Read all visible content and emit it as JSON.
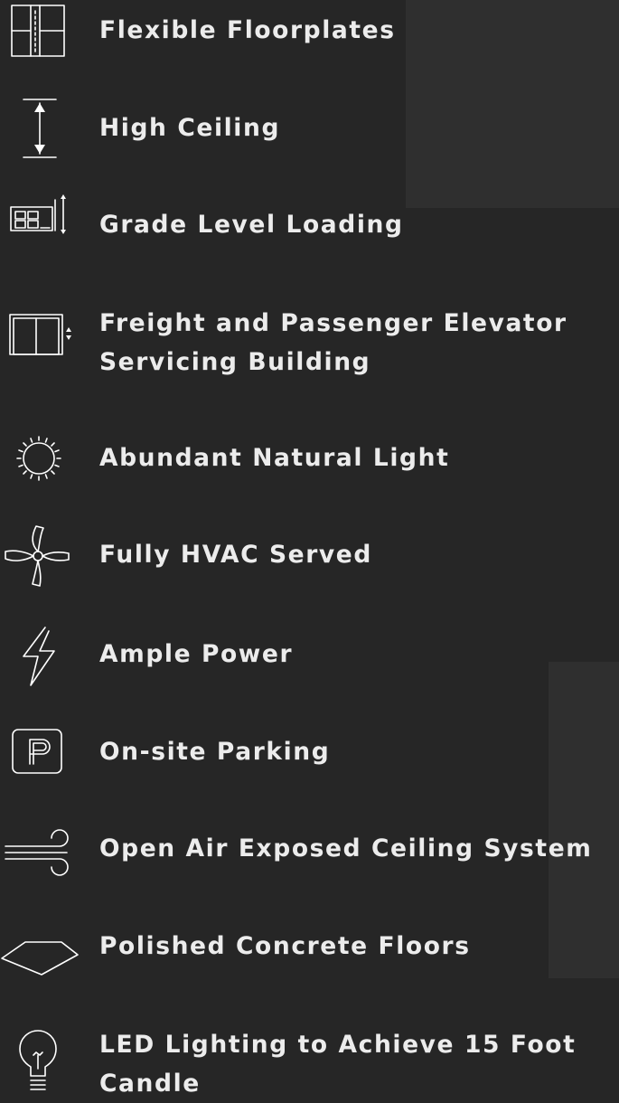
{
  "features": [
    {
      "icon": "floorplan-icon",
      "label": "Flexible Floorplates"
    },
    {
      "icon": "ceiling-height-icon",
      "label": "High Ceiling"
    },
    {
      "icon": "loading-dock-icon",
      "label": "Grade Level Loading"
    },
    {
      "icon": "elevator-icon",
      "label_line1": "Freight and Passenger Elevator",
      "label_line2": "Servicing Building"
    },
    {
      "icon": "sun-icon",
      "label": "Abundant Natural Light"
    },
    {
      "icon": "fan-icon",
      "label": "Fully HVAC Served"
    },
    {
      "icon": "lightning-bolt-icon",
      "label": "Ample Power"
    },
    {
      "icon": "parking-icon",
      "label": "On-site Parking"
    },
    {
      "icon": "wind-icon",
      "label": "Open Air Exposed Ceiling System"
    },
    {
      "icon": "concrete-floor-icon",
      "label": "Polished Concrete Floors"
    },
    {
      "icon": "light-bulb-icon",
      "label_line1": "LED Lighting to Achieve 15 Foot",
      "label_line2": "Candle"
    }
  ],
  "colors": {
    "background": "#262626",
    "panel": "#2f2f2f",
    "text": "#ececec",
    "icon": "#ffffff"
  }
}
